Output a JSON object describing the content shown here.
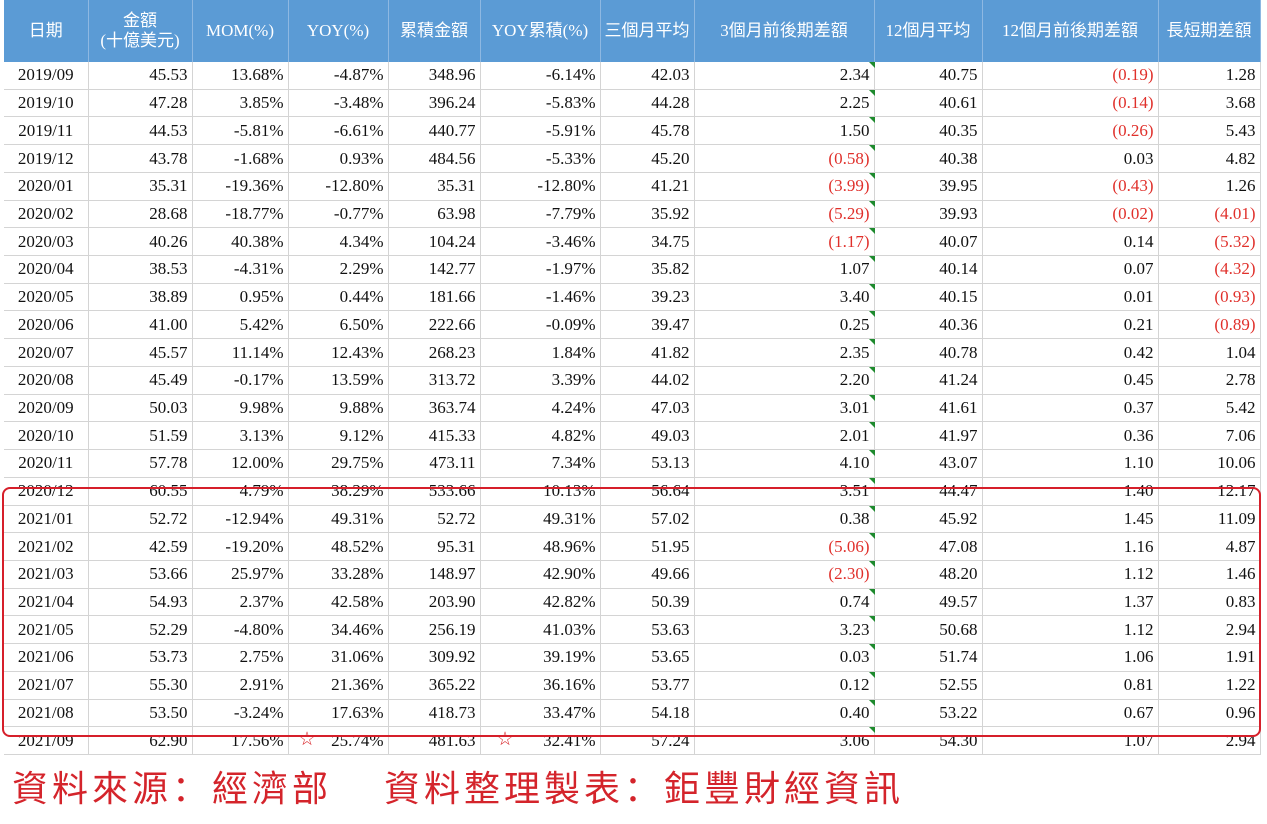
{
  "table": {
    "headers": [
      "日期",
      "金額\n(十億美元)",
      "MOM(%)",
      "YOY(%)",
      "累積金額",
      "YOY累積(%)",
      "三個月平均",
      "3個月前後期差額",
      "12個月平均",
      "12個月前後期差額",
      "長短期差額"
    ],
    "rows": [
      [
        "2019/09",
        "45.53",
        "13.68%",
        "-4.87%",
        "348.96",
        "-6.14%",
        "42.03",
        "2.34",
        "40.75",
        "(0.19)",
        "1.28"
      ],
      [
        "2019/10",
        "47.28",
        "3.85%",
        "-3.48%",
        "396.24",
        "-5.83%",
        "44.28",
        "2.25",
        "40.61",
        "(0.14)",
        "3.68"
      ],
      [
        "2019/11",
        "44.53",
        "-5.81%",
        "-6.61%",
        "440.77",
        "-5.91%",
        "45.78",
        "1.50",
        "40.35",
        "(0.26)",
        "5.43"
      ],
      [
        "2019/12",
        "43.78",
        "-1.68%",
        "0.93%",
        "484.56",
        "-5.33%",
        "45.20",
        "(0.58)",
        "40.38",
        "0.03",
        "4.82"
      ],
      [
        "2020/01",
        "35.31",
        "-19.36%",
        "-12.80%",
        "35.31",
        "-12.80%",
        "41.21",
        "(3.99)",
        "39.95",
        "(0.43)",
        "1.26"
      ],
      [
        "2020/02",
        "28.68",
        "-18.77%",
        "-0.77%",
        "63.98",
        "-7.79%",
        "35.92",
        "(5.29)",
        "39.93",
        "(0.02)",
        "(4.01)"
      ],
      [
        "2020/03",
        "40.26",
        "40.38%",
        "4.34%",
        "104.24",
        "-3.46%",
        "34.75",
        "(1.17)",
        "40.07",
        "0.14",
        "(5.32)"
      ],
      [
        "2020/04",
        "38.53",
        "-4.31%",
        "2.29%",
        "142.77",
        "-1.97%",
        "35.82",
        "1.07",
        "40.14",
        "0.07",
        "(4.32)"
      ],
      [
        "2020/05",
        "38.89",
        "0.95%",
        "0.44%",
        "181.66",
        "-1.46%",
        "39.23",
        "3.40",
        "40.15",
        "0.01",
        "(0.93)"
      ],
      [
        "2020/06",
        "41.00",
        "5.42%",
        "6.50%",
        "222.66",
        "-0.09%",
        "39.47",
        "0.25",
        "40.36",
        "0.21",
        "(0.89)"
      ],
      [
        "2020/07",
        "45.57",
        "11.14%",
        "12.43%",
        "268.23",
        "1.84%",
        "41.82",
        "2.35",
        "40.78",
        "0.42",
        "1.04"
      ],
      [
        "2020/08",
        "45.49",
        "-0.17%",
        "13.59%",
        "313.72",
        "3.39%",
        "44.02",
        "2.20",
        "41.24",
        "0.45",
        "2.78"
      ],
      [
        "2020/09",
        "50.03",
        "9.98%",
        "9.88%",
        "363.74",
        "4.24%",
        "47.03",
        "3.01",
        "41.61",
        "0.37",
        "5.42"
      ],
      [
        "2020/10",
        "51.59",
        "3.13%",
        "9.12%",
        "415.33",
        "4.82%",
        "49.03",
        "2.01",
        "41.97",
        "0.36",
        "7.06"
      ],
      [
        "2020/11",
        "57.78",
        "12.00%",
        "29.75%",
        "473.11",
        "7.34%",
        "53.13",
        "4.10",
        "43.07",
        "1.10",
        "10.06"
      ],
      [
        "2020/12",
        "60.55",
        "4.79%",
        "38.29%",
        "533.66",
        "10.13%",
        "56.64",
        "3.51",
        "44.47",
        "1.40",
        "12.17"
      ],
      [
        "2021/01",
        "52.72",
        "-12.94%",
        "49.31%",
        "52.72",
        "49.31%",
        "57.02",
        "0.38",
        "45.92",
        "1.45",
        "11.09"
      ],
      [
        "2021/02",
        "42.59",
        "-19.20%",
        "48.52%",
        "95.31",
        "48.96%",
        "51.95",
        "(5.06)",
        "47.08",
        "1.16",
        "4.87"
      ],
      [
        "2021/03",
        "53.66",
        "25.97%",
        "33.28%",
        "148.97",
        "42.90%",
        "49.66",
        "(2.30)",
        "48.20",
        "1.12",
        "1.46"
      ],
      [
        "2021/04",
        "54.93",
        "2.37%",
        "42.58%",
        "203.90",
        "42.82%",
        "50.39",
        "0.74",
        "49.57",
        "1.37",
        "0.83"
      ],
      [
        "2021/05",
        "52.29",
        "-4.80%",
        "34.46%",
        "256.19",
        "41.03%",
        "53.63",
        "3.23",
        "50.68",
        "1.12",
        "2.94"
      ],
      [
        "2021/06",
        "53.73",
        "2.75%",
        "31.06%",
        "309.92",
        "39.19%",
        "53.65",
        "0.03",
        "51.74",
        "1.06",
        "1.91"
      ],
      [
        "2021/07",
        "55.30",
        "2.91%",
        "21.36%",
        "365.22",
        "36.16%",
        "53.77",
        "0.12",
        "52.55",
        "0.81",
        "1.22"
      ],
      [
        "2021/08",
        "53.50",
        "-3.24%",
        "17.63%",
        "418.73",
        "33.47%",
        "54.18",
        "0.40",
        "53.22",
        "0.67",
        "0.96"
      ],
      [
        "2021/09",
        "62.90",
        "17.56%",
        "25.74%",
        "481.63",
        "32.41%",
        "57.24",
        "3.06",
        "54.30",
        "1.07",
        "2.94"
      ]
    ]
  },
  "star_glyph": "☆",
  "colors": {
    "header_bg": "#5b9bd5",
    "negative": "#e0302b",
    "highlight_border": "#d61f2a",
    "source_text": "#d4242b"
  },
  "footer": {
    "source": "資料來源：經濟部",
    "compiled": "資料整理製表：鉅豐財經資訊"
  }
}
